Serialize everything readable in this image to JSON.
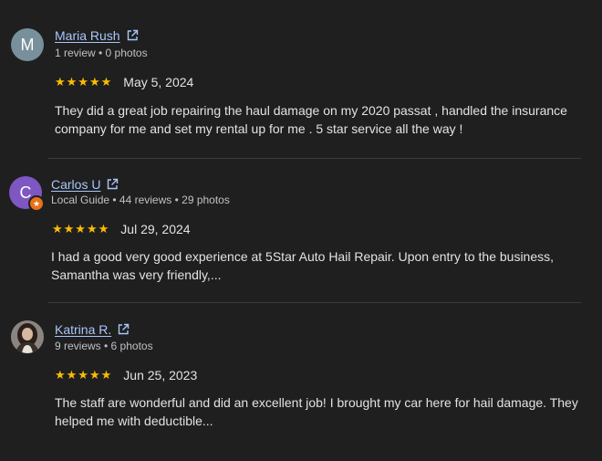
{
  "reviews": [
    {
      "initial": "M",
      "avatar_color": "#78909c",
      "name": "Maria Rush",
      "meta": "1 review • 0 photos",
      "stars": "★★★★★",
      "rating": 5,
      "date": "May 5, 2024",
      "text": "They did a great job repairing the haul damage on my 2020 passat , handled the insurance company for me and set my rental up for me . 5 star service all the way !"
    },
    {
      "initial": "C",
      "avatar_color": "#7e57c2",
      "name": "Carlos U",
      "meta": "Local Guide • 44 reviews • 29 photos",
      "stars": "★★★★★",
      "rating": 5,
      "date": "Jul 29, 2024",
      "text": "I had a good very good experience at 5Star Auto Hail Repair. Upon entry to the business, Samantha was very friendly,..."
    },
    {
      "initial": "",
      "avatar_color": "#5d4e45",
      "name": "Katrina R.",
      "meta": "9 reviews • 6 photos",
      "stars": "★★★★★",
      "rating": 5,
      "date": "Jun 25, 2023",
      "text": "The staff are wonderful and did an excellent job! I brought my car here for hail damage. They helped me with deductible..."
    }
  ],
  "colors": {
    "background": "#1f1f1f",
    "link": "#a8c7fa",
    "star": "#fbbc04",
    "local_guide_badge": "#e8711a"
  }
}
